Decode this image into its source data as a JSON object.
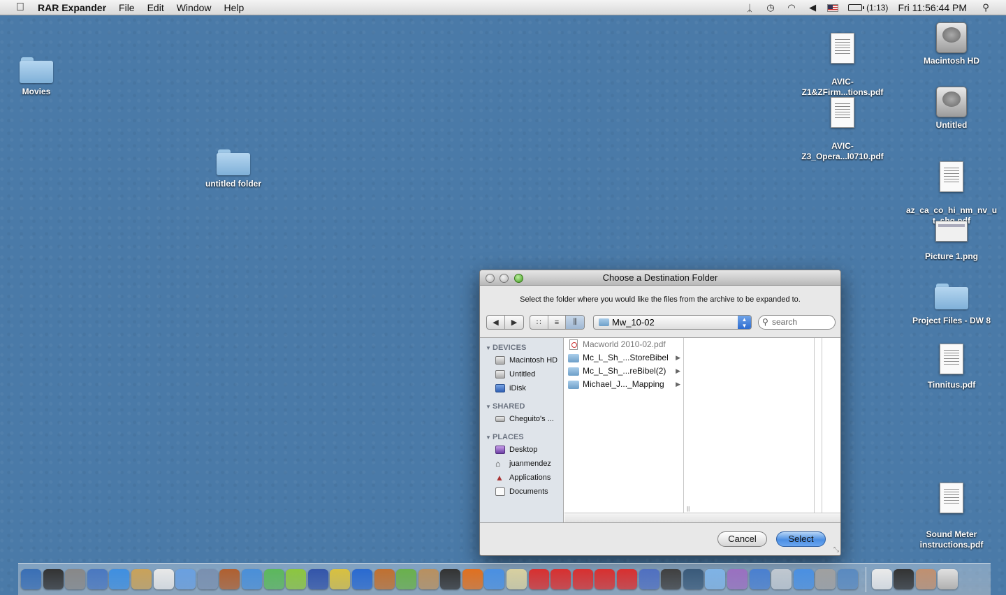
{
  "menubar": {
    "app_name": "RAR Expander",
    "items": [
      "File",
      "Edit",
      "Window",
      "Help"
    ],
    "battery": "(1:13)",
    "clock": "Fri 11:56:44 PM"
  },
  "desktop": {
    "icons": {
      "movies": "Movies",
      "untitled_folder": "untitled folder",
      "avic_z1": "AVIC-\nZ1&ZFirm...tions.pdf",
      "avic_z3": "AVIC-\nZ3_Opera...l0710.pdf",
      "macintosh_hd": "Macintosh HD",
      "untitled": "Untitled",
      "az_pdf": "az_ca_co_hi_nm_nv_u\nt_shg.pdf",
      "picture1": "Picture 1.png",
      "project_files": "Project Files - DW 8",
      "tinnitus": "Tinnitus.pdf",
      "sound_meter": "Sound Meter\ninstructions.pdf"
    }
  },
  "dialog": {
    "title": "Choose a Destination Folder",
    "prompt": "Select the folder where you would like the files from the archive to be expanded to.",
    "location": "Mw_10-02",
    "search_placeholder": "search",
    "sidebar": {
      "devices_header": "DEVICES",
      "devices": [
        "Macintosh HD",
        "Untitled",
        "iDisk"
      ],
      "shared_header": "SHARED",
      "shared": [
        "Cheguito's ..."
      ],
      "places_header": "PLACES",
      "places": [
        "Desktop",
        "juanmendez",
        "Applications",
        "Documents"
      ]
    },
    "files": [
      "Macworld 2010-02.pdf",
      "Mc_L_Sh_...StoreBibel",
      "Mc_L_Sh_...reBibel(2)",
      "Michael_J..._Mapping"
    ],
    "cancel_label": "Cancel",
    "select_label": "Select"
  },
  "dock": {
    "icon_colors": [
      "#3a6fb5",
      "#333333",
      "#888888",
      "#4a78c0",
      "#3f8fe0",
      "#c9a25a",
      "#e8e8e8",
      "#6aa0e0",
      "#7a90b0",
      "#b06030",
      "#4a8fd8",
      "#5cb85c",
      "#8cc63f",
      "#3355aa",
      "#d8c040",
      "#2a6ad0",
      "#c07030",
      "#6ab04c",
      "#b89060",
      "#333333",
      "#e07020",
      "#4a90e2",
      "#d8d0a0",
      "#d83030",
      "#d83030",
      "#d83030",
      "#d83030",
      "#d83030",
      "#5070c0",
      "#404040",
      "#3a5a7a",
      "#7fb3e6",
      "#9a70c0",
      "#4a80d0",
      "#c0c8d0",
      "#4a90e2",
      "#a0a0a0",
      "#5a8ac0",
      "#eaeaea",
      "#333333",
      "#c09070"
    ],
    "trash_color": "#b0b0b0"
  }
}
